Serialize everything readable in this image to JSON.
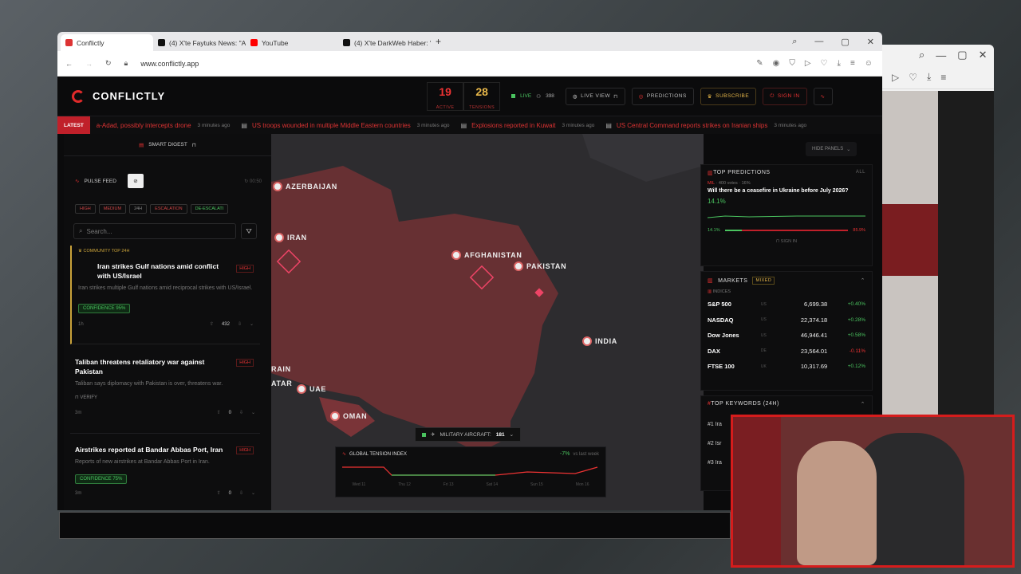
{
  "browser": {
    "tabs": [
      {
        "label": "Conflictly",
        "active": true,
        "color": "#d33"
      },
      {
        "label": "(4) X'te Faytuks News: \"A",
        "active": false,
        "color": "#111"
      },
      {
        "label": "YouTube",
        "active": false,
        "color": "#f00"
      },
      {
        "label": "(4) X'te DarkWeb Haber: \"",
        "active": false,
        "color": "#111"
      }
    ],
    "url": "www.conflictly.app"
  },
  "app": {
    "brand": "CONFLICTLY",
    "stats": [
      {
        "value": "19",
        "label": "ACTIVE",
        "color": "#e33"
      },
      {
        "value": "28",
        "label": "TENSIONS",
        "color": "#e8b84a"
      }
    ],
    "live_label": "LIVE",
    "live_count": "398",
    "buttons": {
      "live_view": "LIVE VIEW",
      "predictions": "PREDICTIONS",
      "subscribe": "SUBSCRIBE",
      "sign_in": "SIGN IN"
    }
  },
  "ticker": {
    "label": "LATEST",
    "items": [
      {
        "text": "a-Adad, possibly intercepts drone",
        "time": "3 minutes ago"
      },
      {
        "text": "US troops wounded in multiple Middle Eastern countries",
        "time": "3 minutes ago"
      },
      {
        "text": "Explosions reported in Kuwait",
        "time": "3 minutes ago"
      },
      {
        "text": "US Central Command reports strikes on Iranian ships",
        "time": "3 minutes ago"
      }
    ]
  },
  "left_panel": {
    "smart_digest": "SMART DIGEST",
    "pulse_feed": "PULSE FEED",
    "feed_time": "00:50",
    "filters": [
      "HIGH",
      "MEDIUM",
      "24H",
      "ESCALATION",
      "DE-ESCALATI"
    ],
    "search_placeholder": "Search...",
    "community_label": "COMMUNITY TOP 24H",
    "cards": [
      {
        "title": "Iran strikes Gulf nations amid conflict with US/Israel",
        "body": "Iran strikes multiple Gulf nations amid reciprocal strikes with US/Israel.",
        "severity": "HIGH",
        "confidence": "CONFIDENCE 95%",
        "votes": "432",
        "age": "1h"
      },
      {
        "title": "Taliban threatens retaliatory war against Pakistan",
        "body": "Taliban says diplomacy with Pakistan is over, threatens war.",
        "severity": "HIGH",
        "verify": "VERIFY",
        "votes": "0",
        "age": "3m"
      },
      {
        "title": "Airstrikes reported at Bandar Abbas Port, Iran",
        "body": "Reports of new airstrikes at Bandar Abbas Port in Iran.",
        "severity": "HIGH",
        "confidence": "CONFIDENCE 75%",
        "votes": "0",
        "age": "3m"
      }
    ]
  },
  "map": {
    "hide_panels": "HIDE PANELS",
    "countries": [
      "AZERBAIJAN",
      "IRAN",
      "AFGHANISTAN",
      "PAKISTAN",
      "INDIA",
      "UAE",
      "OMAN",
      "RAIN",
      "ATAR"
    ],
    "aircraft_label": "MILITARY AIRCRAFT:",
    "aircraft_count": "181",
    "tension": {
      "title": "GLOBAL TENSION INDEX",
      "change": "-7%",
      "change_note": "vs last week",
      "days": [
        "Wed 11",
        "Thu 12",
        "Fri 13",
        "Sat 14",
        "Sun 15",
        "Mon 16"
      ]
    }
  },
  "right_panel": {
    "predictions_title": "TOP PREDICTIONS",
    "all_label": "ALL",
    "prediction": {
      "tag": "MIL",
      "votes": "400 votes",
      "pct_small": "16%",
      "question": "Will there be a ceasefire in Ukraine before July 2026?",
      "value": "14.1%",
      "low": "14.1%",
      "high": "85.9%",
      "sign_in": "SIGN IN"
    },
    "markets_title": "MARKETS",
    "markets_badge": "MIXED",
    "indices_label": "INDICES",
    "markets": [
      {
        "name": "S&P 500",
        "region": "US",
        "value": "6,699.38",
        "change": "+0.40%",
        "neg": false
      },
      {
        "name": "NASDAQ",
        "region": "US",
        "value": "22,374.18",
        "change": "+0.28%",
        "neg": false
      },
      {
        "name": "Dow Jones",
        "region": "US",
        "value": "46,946.41",
        "change": "+0.58%",
        "neg": false
      },
      {
        "name": "DAX",
        "region": "DE",
        "value": "23,564.01",
        "change": "-0.11%",
        "neg": true
      },
      {
        "name": "FTSE 100",
        "region": "UK",
        "value": "10,317.69",
        "change": "+0.12%",
        "neg": false
      }
    ],
    "keywords_title": "TOP KEYWORDS (24H)",
    "keywords": [
      "#1 Ira",
      "#2 Isr",
      "#3 Ira"
    ]
  },
  "colors": {
    "accent": "#e02a2a",
    "positive": "#4ac35f",
    "warning": "#e8b84a"
  }
}
